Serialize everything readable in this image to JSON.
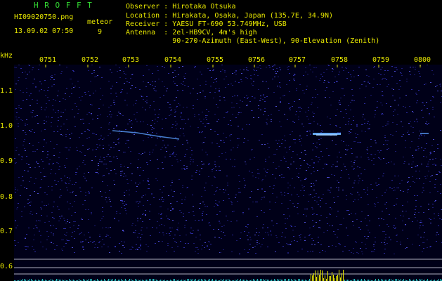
{
  "header": {
    "title": "H R O F F T",
    "filename": "HI09020750.png",
    "date_time": "13.09.02 07:50",
    "meteor_label": "meteor",
    "meteor_count": "9"
  },
  "info": {
    "observer_line": "Observer : Hirotaka Otsuka",
    "location_line": "Location : Hirakata, Osaka, Japan (135.7E, 34.9N)",
    "receiver_line": "Receiver : YAESU FT-690 53.749MHz, USB",
    "antenna_line": "Antenna  : 2el-HB9CV, 4m's high",
    "antenna_line2": "           90-270-Azimuth (East-West), 90-Elevation (Zenith)"
  },
  "axes": {
    "y_unit": "kHz",
    "x_ticks": [
      "0751",
      "0752",
      "0753",
      "0754",
      "0755",
      "0756",
      "0757",
      "0758",
      "0759",
      "0800"
    ],
    "y_ticks": [
      "1.1",
      "1.0",
      "0.9",
      "0.8",
      "0.7",
      "0.6"
    ]
  },
  "colors": {
    "label": "#e8e800",
    "title": "#33dd33",
    "signal": "#5aa0ff",
    "noise": "#2a2aa0",
    "baseline": "#22c0c0",
    "burst": "#e8e800"
  }
}
